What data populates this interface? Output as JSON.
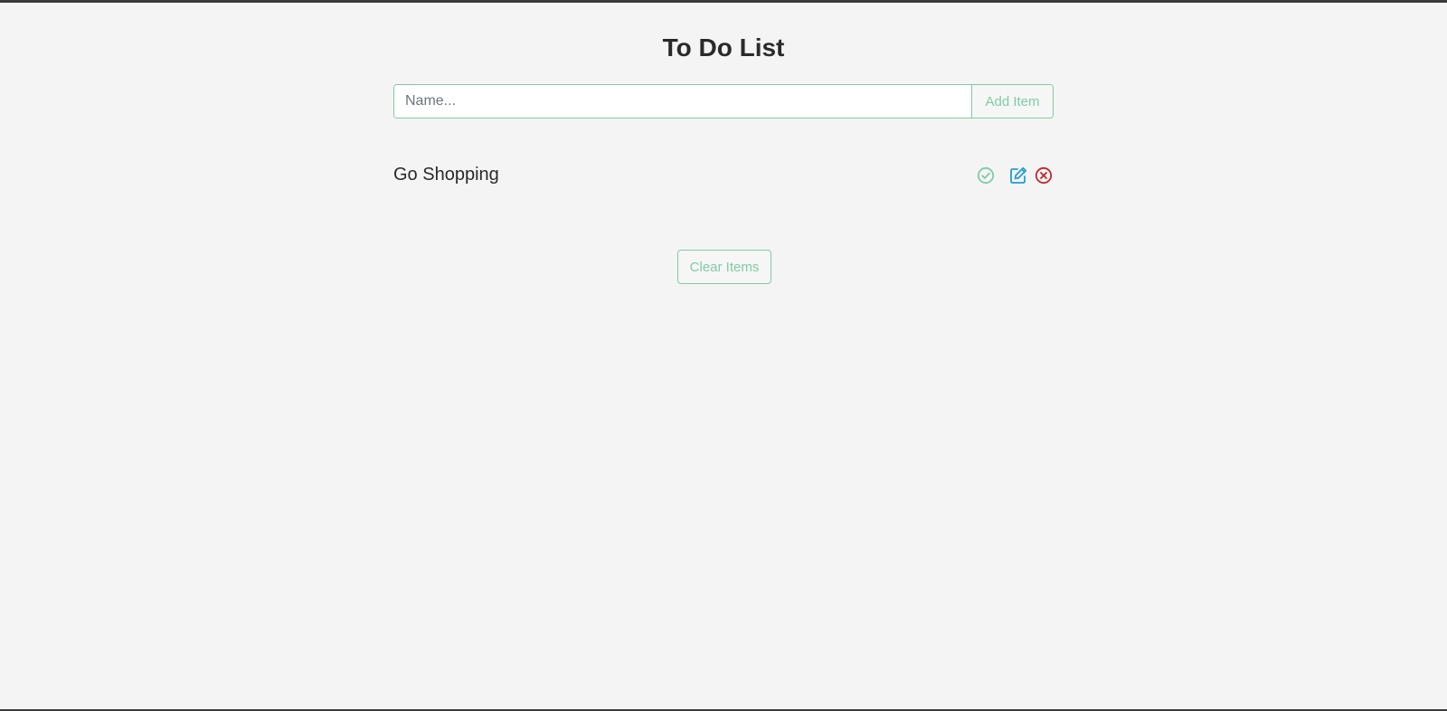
{
  "header": {
    "title": "To Do List"
  },
  "form": {
    "name_value": "",
    "name_placeholder": "Name...",
    "add_label": "Add Item"
  },
  "items": [
    {
      "text": "Go Shopping",
      "actions": [
        {
          "name": "check-icon",
          "color": "#7fcba6"
        },
        {
          "name": "edit-icon",
          "color": "#1f9fd0"
        },
        {
          "name": "delete-icon",
          "color": "#c0272d"
        }
      ]
    }
  ],
  "footer": {
    "clear_label": "Clear Items"
  },
  "colors": {
    "background": "#f4f4f4",
    "accent": "#7fcba6",
    "edit": "#1f9fd0",
    "delete": "#c0272d",
    "text": "#2a2a2a"
  }
}
